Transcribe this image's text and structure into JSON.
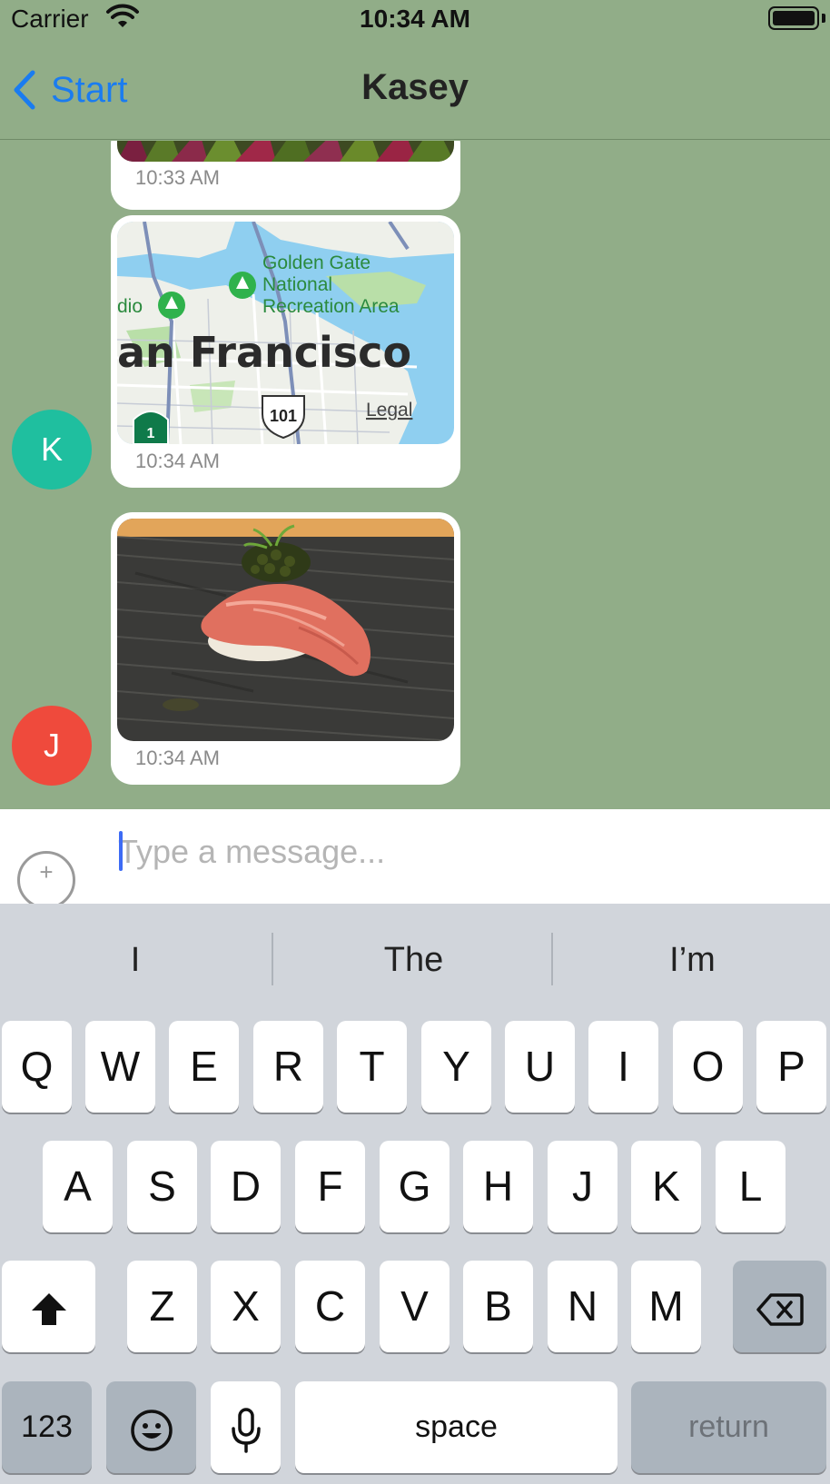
{
  "status_bar": {
    "carrier": "Carrier",
    "time": "10:34 AM"
  },
  "nav": {
    "back_label": "Start",
    "title": "Kasey"
  },
  "messages": [
    {
      "time": "10:33 AM"
    },
    {
      "avatar_initial": "K",
      "avatar_color": "#1fbf9f",
      "time": "10:34 AM",
      "map": {
        "park": "Golden Gate National Recreation Area",
        "park_line1": "Golden Gate",
        "park_line2": "National",
        "park_line3": "Recreation Area",
        "city_label": "an Francisco",
        "left_label": "dio",
        "hwy_101": "101",
        "hwy_1": "1",
        "legal": "Legal"
      }
    },
    {
      "avatar_initial": "J",
      "avatar_color": "#ef4a3c",
      "time": "10:34 AM"
    }
  ],
  "input": {
    "placeholder": "Type a message...",
    "add_icon": "+"
  },
  "keyboard": {
    "suggestions": [
      "I",
      "The",
      "I’m"
    ],
    "row1": [
      "Q",
      "W",
      "E",
      "R",
      "T",
      "Y",
      "U",
      "I",
      "O",
      "P"
    ],
    "row2": [
      "A",
      "S",
      "D",
      "F",
      "G",
      "H",
      "J",
      "K",
      "L"
    ],
    "row3": [
      "Z",
      "X",
      "C",
      "V",
      "B",
      "N",
      "M"
    ],
    "numbers_label": "123",
    "space_label": "space",
    "return_label": "return"
  }
}
